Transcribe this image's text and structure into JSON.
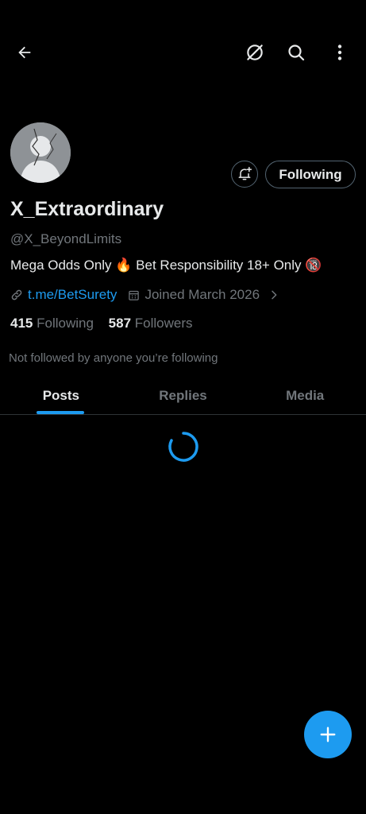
{
  "top_bar": {
    "back_icon": "arrow-left-icon",
    "grok_icon": "grok-icon",
    "search_icon": "search-icon",
    "more_icon": "more-vertical-icon"
  },
  "profile": {
    "display_name": "X_Extraordinary",
    "handle": "@X_BeyondLimits",
    "bio": "Mega Odds Only 🔥 Bet Responsibility 18+ Only 🔞",
    "link": "t.me/BetSurety",
    "joined": "Joined March 2026",
    "following_count": "415",
    "following_label": "Following",
    "followers_count": "587",
    "followers_label": "Followers",
    "not_followed": "Not followed by anyone you’re following"
  },
  "actions": {
    "follow_state_label": "Following",
    "notify_icon": "bell-plus-icon"
  },
  "tabs": [
    {
      "label": "Posts",
      "active": true
    },
    {
      "label": "Replies",
      "active": false
    },
    {
      "label": "Media",
      "active": false
    }
  ],
  "fab": {
    "icon": "plus-icon"
  },
  "colors": {
    "accent": "#1d9bf0",
    "background": "#000000",
    "text_primary": "#e7e9ea",
    "text_secondary": "#71767b"
  }
}
